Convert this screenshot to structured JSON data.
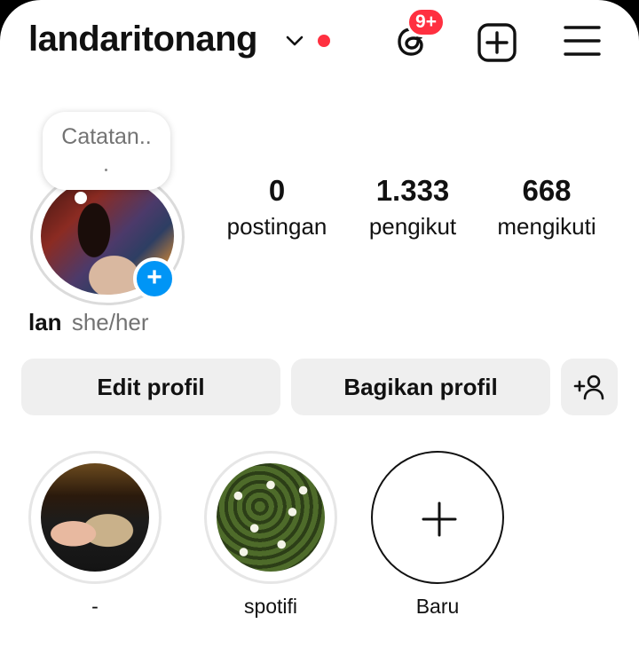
{
  "header": {
    "username": "landaritonang",
    "notification_badge": "9+",
    "icons": [
      "chevron-down-icon",
      "threads-icon",
      "new-post-icon",
      "menu-icon"
    ],
    "accent_red": "#ff3040"
  },
  "profile": {
    "note_text": "Catatan..",
    "name": "lan",
    "pronouns": "she/her",
    "add_story_icon": "+",
    "stats": [
      {
        "value": "0",
        "label": "postingan"
      },
      {
        "value": "1.333",
        "label": "pengikut"
      },
      {
        "value": "668",
        "label": "mengikuti"
      }
    ]
  },
  "actions": {
    "edit_label": "Edit profil",
    "share_label": "Bagikan profil"
  },
  "highlights": [
    {
      "label": "-"
    },
    {
      "label": "spotifi"
    },
    {
      "label": "Baru"
    }
  ],
  "colors": {
    "accent_blue": "#0095f6",
    "button_bg": "#efefef"
  }
}
